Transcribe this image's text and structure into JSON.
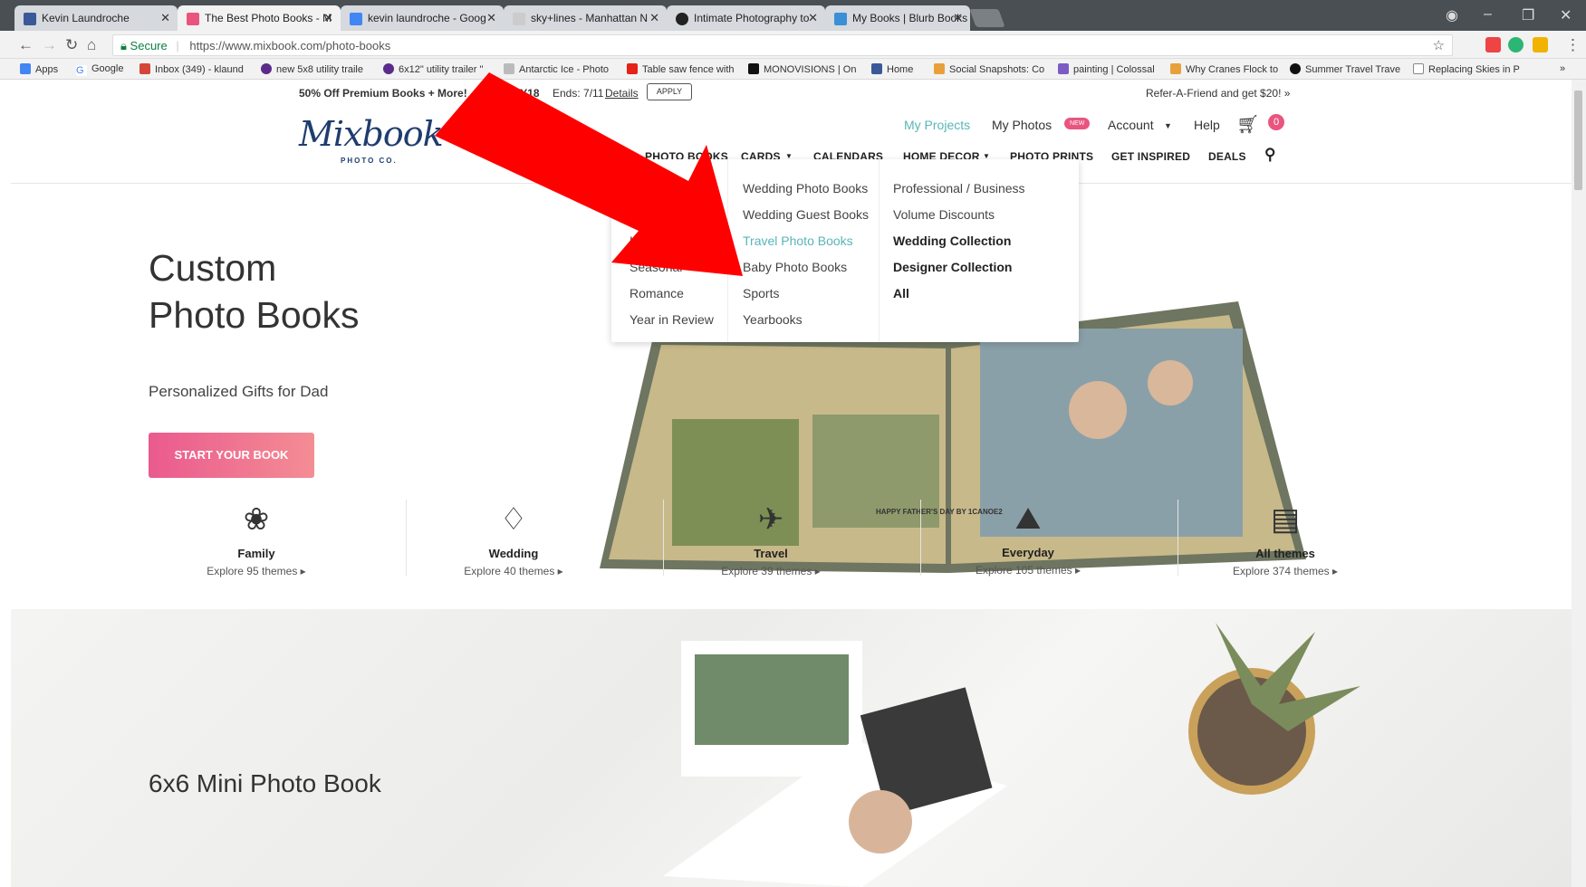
{
  "browser": {
    "tabs": [
      {
        "title": "Kevin Laundroche",
        "color": "#3b5998"
      },
      {
        "title": "The Best Photo Books - M",
        "color": "#e9557f"
      },
      {
        "title": "kevin laundroche - Goog",
        "color": "#4285f4"
      },
      {
        "title": "sky+lines - Manhattan N",
        "color": "#cccccc"
      },
      {
        "title": "Intimate Photography to",
        "color": "#222222"
      },
      {
        "title": "My Books | Blurb Books",
        "color": "#3b8fd6"
      }
    ],
    "security_label": "Secure",
    "url": "https://www.mixbook.com/photo-books",
    "bookmarks": [
      "Apps",
      "Google",
      "Inbox (349) - klaund",
      "new 5x8 utility traile",
      "6x12\" utility trailer \"",
      "Antarctic Ice - Photo",
      "Table saw fence with",
      "MONOVISIONS | On",
      "Home",
      "Social Snapshots: Co",
      "painting | Colossal",
      "Why Cranes Flock to",
      "Summer Travel Trave",
      "Replacing Skies in P"
    ],
    "bookmarks_more": "»"
  },
  "promo": {
    "left_text": "50% Off Premium Books + More!",
    "code": "LY18",
    "ends": "Ends: 7/11",
    "details": "Details",
    "apply": "APPLY",
    "right_text": "Refer-A-Friend and get $20! »"
  },
  "header": {
    "logo": "Mixbook",
    "logo_sub": "PHOTO CO.",
    "links": [
      "My Projects",
      "My Photos",
      "Account",
      "Help"
    ],
    "new_badge": "NEW",
    "cart_count": "0",
    "nav": [
      "PHOTO BOOKS",
      "CARDS",
      "CALENDARS",
      "HOME DECOR",
      "PHOTO PRINTS",
      "GET INSPIRED",
      "DEALS"
    ]
  },
  "dropdown": {
    "col1": [
      "Kids",
      "Seasonal",
      "Romance",
      "Year in Review"
    ],
    "col2": [
      "Wedding Photo Books",
      "Wedding Guest Books",
      "Travel Photo Books",
      "Baby Photo Books",
      "Sports",
      "Yearbooks"
    ],
    "col3_plain": [
      "Professional / Business",
      "Volume Discounts"
    ],
    "col3_bold": [
      "Wedding Collection",
      "Designer Collection",
      "All"
    ]
  },
  "hero": {
    "title_line1": "Custom",
    "title_line2": "Photo Books",
    "subtitle": "Personalized Gifts for Dad",
    "cta": "START YOUR BOOK",
    "caption": "HAPPY FATHER'S DAY BY 1CANOE2"
  },
  "categories": [
    {
      "name": "Family",
      "sub": "Explore 95 themes ▸"
    },
    {
      "name": "Wedding",
      "sub": "Explore 40 themes ▸"
    },
    {
      "name": "Travel",
      "sub": "Explore 39 themes ▸"
    },
    {
      "name": "Everyday",
      "sub": "Explore 105 themes ▸"
    },
    {
      "name": "All themes",
      "sub": "Explore 374 themes ▸"
    }
  ],
  "mini": {
    "title": "6x6 Mini Photo Book"
  },
  "colors": {
    "accent_teal": "#58b5b8",
    "cta_pink": "#ea5a8e",
    "logo_navy": "#1f3d6e",
    "arrow_red": "#ff0000"
  }
}
